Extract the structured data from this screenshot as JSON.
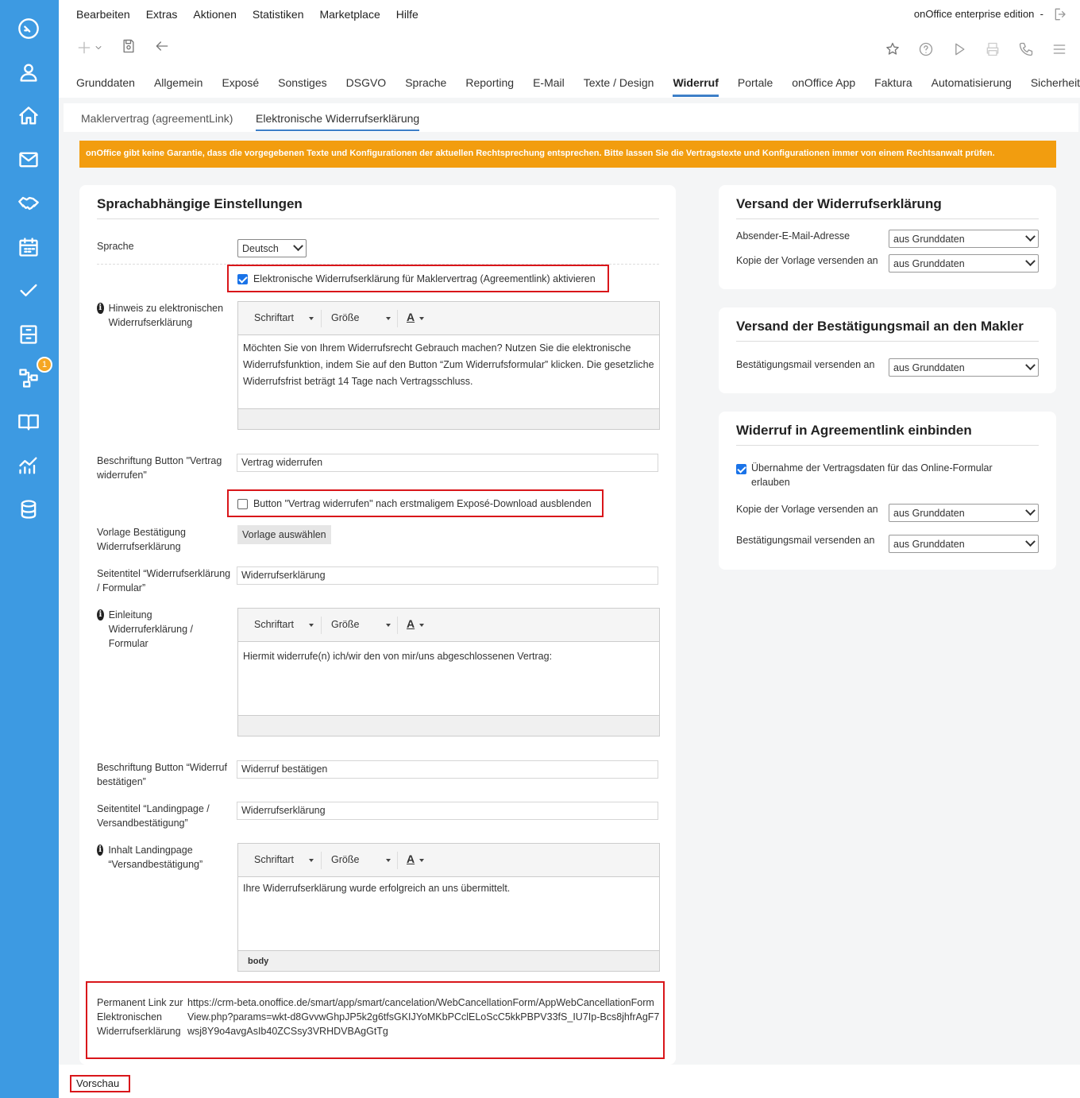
{
  "sidebar": {
    "badge": "1"
  },
  "menu": [
    "Bearbeiten",
    "Extras",
    "Aktionen",
    "Statistiken",
    "Marketplace",
    "Hilfe"
  ],
  "edition": "onOffice enterprise edition",
  "edition_sep": "-",
  "tabs": [
    "Grunddaten",
    "Allgemein",
    "Exposé",
    "Sonstiges",
    "DSGVO",
    "Sprache",
    "Reporting",
    "E-Mail",
    "Texte / Design",
    "Widerruf",
    "Portale",
    "onOffice App",
    "Faktura",
    "Automatisierung",
    "Sicherheit"
  ],
  "active_tab": "Widerruf",
  "subtabs": [
    "Maklervertrag (agreementLink)",
    "Elektronische Widerrufserklärung"
  ],
  "warning": "onOffice gibt keine Garantie, dass die vorgegebenen Texte und Konfigurationen der aktuellen Rechtsprechung entsprechen. Bitte lassen Sie die Vertragstexte und Konfigurationen immer von einem Rechtsanwalt prüfen.",
  "left": {
    "title": "Sprachabhängige Einstellungen",
    "sprache_label": "Sprache",
    "sprache_value": "Deutsch",
    "activate_label": "Elektronische Widerrufserklärung für Maklervertrag (Agreementlink) aktivieren",
    "activate_checked": true,
    "hinweis_label": "Hinweis zu elektronischen Widerrufserklärung",
    "editor_font": "Schriftart",
    "editor_size": "Größe",
    "editor_color": "A",
    "hinweis_text": "Möchten Sie von Ihrem Widerrufsrecht Gebrauch machen? Nutzen Sie die elektronische Widerrufsfunktion, indem Sie auf den Button “Zum Widerrufsformular” klicken. Die gesetzliche Widerrufsfrist beträgt 14 Tage nach Vertragsschluss.",
    "btn_label_label": "Beschriftung Button \"Vertrag widerrufen\"",
    "btn_label_value": "Vertrag widerrufen",
    "hide_btn_label": "Button \"Vertrag widerrufen\" nach erstmaligem Exposé-Download ausblenden",
    "hide_btn_checked": false,
    "vorlage_label": "Vorlage Bestätigung Widerrufserklärung",
    "vorlage_button": "Vorlage auswählen",
    "seitentitel_label": "Seitentitel “Widerrufserklärung / Formular”",
    "seitentitel_value": "Widerrufserklärung",
    "einleitung_label": "Einleitung Widerruferklärung / Formular",
    "einleitung_text": "Hiermit widerrufe(n) ich/wir den von mir/uns abgeschlossenen Vertrag:",
    "confirm_btn_label": "Beschriftung Button “Widerruf bestätigen”",
    "confirm_btn_value": "Widerruf bestätigen",
    "landing_title_label": "Seitentitel “Landingpage / Versandbestätigung”",
    "landing_title_value": "Widerrufserklärung",
    "landing_content_label": "Inhalt Landingpage “Versandbestätigung”",
    "landing_content_text": "Ihre Widerrufserklärung wurde erfolgreich an uns übermittelt.",
    "landing_footer": "body",
    "permalink_label": "Permanent Link zur Elektronischen Widerrufserklärung",
    "permalink_value": "https://crm-beta.onoffice.de/smart/app/smart/cancelation/WebCancellationForm/AppWebCancellationFormView.php?params=wkt-d8GvvwGhpJP5k2g6tfsGKIJYoMKbPCclELoScC5kkPBPV33fS_IU7Ip-Bcs8jhfrAgF7wsj8Y9o4avgAsIb40ZCSsy3VRHDVBAgGtTg"
  },
  "card1": {
    "title": "Versand der Widerrufserklärung",
    "sender_label": "Absender-E-Mail-Adresse",
    "sender_value": "aus Grunddaten",
    "copy_label": "Kopie der Vorlage versenden an",
    "copy_value": "aus Grunddaten"
  },
  "card2": {
    "title": "Versand der Bestätigungsmail an den Makler",
    "confirm_label": "Bestätigungsmail versenden an",
    "confirm_value": "aus Grunddaten"
  },
  "card3": {
    "title": "Widerruf in Agreementlink einbinden",
    "take_label": "Übernahme der Vertragsdaten für das Online-Formular erlauben",
    "take_checked": true,
    "copy_label": "Kopie der Vorlage versenden an",
    "copy_value": "aus Grunddaten",
    "confirm_label": "Bestätigungsmail versenden an",
    "confirm_value": "aus Grunddaten"
  },
  "footer": {
    "preview": "Vorschau"
  }
}
